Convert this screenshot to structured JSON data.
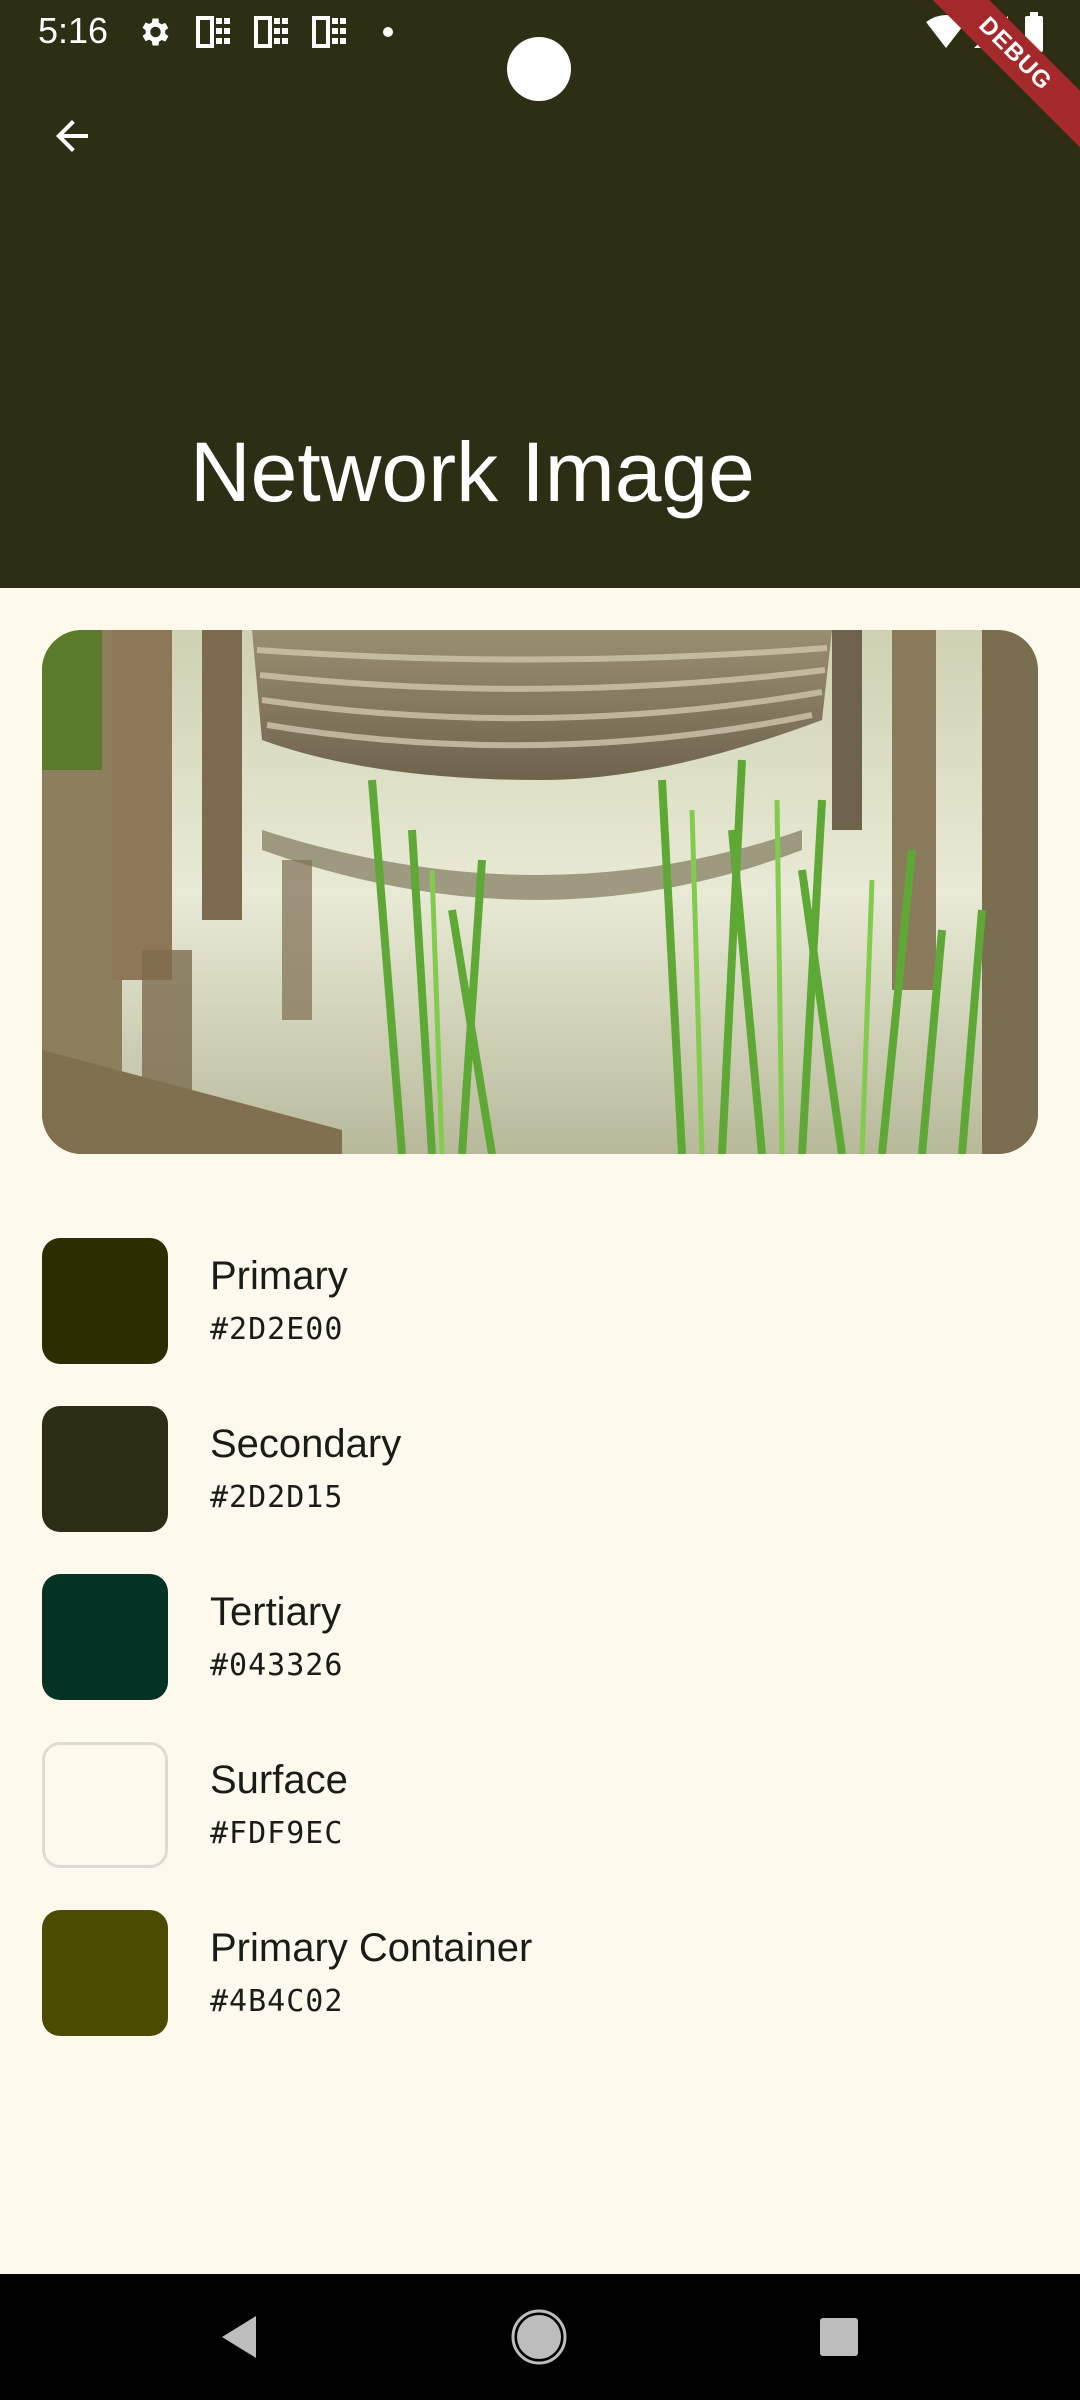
{
  "status_bar": {
    "time": "5:16",
    "icons": [
      "settings-icon",
      "sim-card-icon",
      "sim-card-icon",
      "sim-card-icon",
      "notification-dot-icon",
      "wifi-icon",
      "signal-icon",
      "battery-icon"
    ],
    "debug_label": "DEBUG"
  },
  "app_bar": {
    "back_icon": "arrow-back-icon",
    "title": "Network Image",
    "background_color": "#2D2D15"
  },
  "hero_image": {
    "description_icon": "landscape-photo"
  },
  "swatches": [
    {
      "label": "Primary",
      "hex": "#2D2E00",
      "color": "#2D2E00"
    },
    {
      "label": "Secondary",
      "hex": "#2D2D15",
      "color": "#2D2D15"
    },
    {
      "label": "Tertiary",
      "hex": "#043326",
      "color": "#043326"
    },
    {
      "label": "Surface",
      "hex": "#FDF9EC",
      "color": "#FDF9EC"
    },
    {
      "label": "Primary Container",
      "hex": "#4B4C02",
      "color": "#4B4C02"
    }
  ],
  "nav_bar": {
    "buttons": [
      "back-triangle-icon",
      "home-circle-icon",
      "recents-square-icon"
    ]
  }
}
